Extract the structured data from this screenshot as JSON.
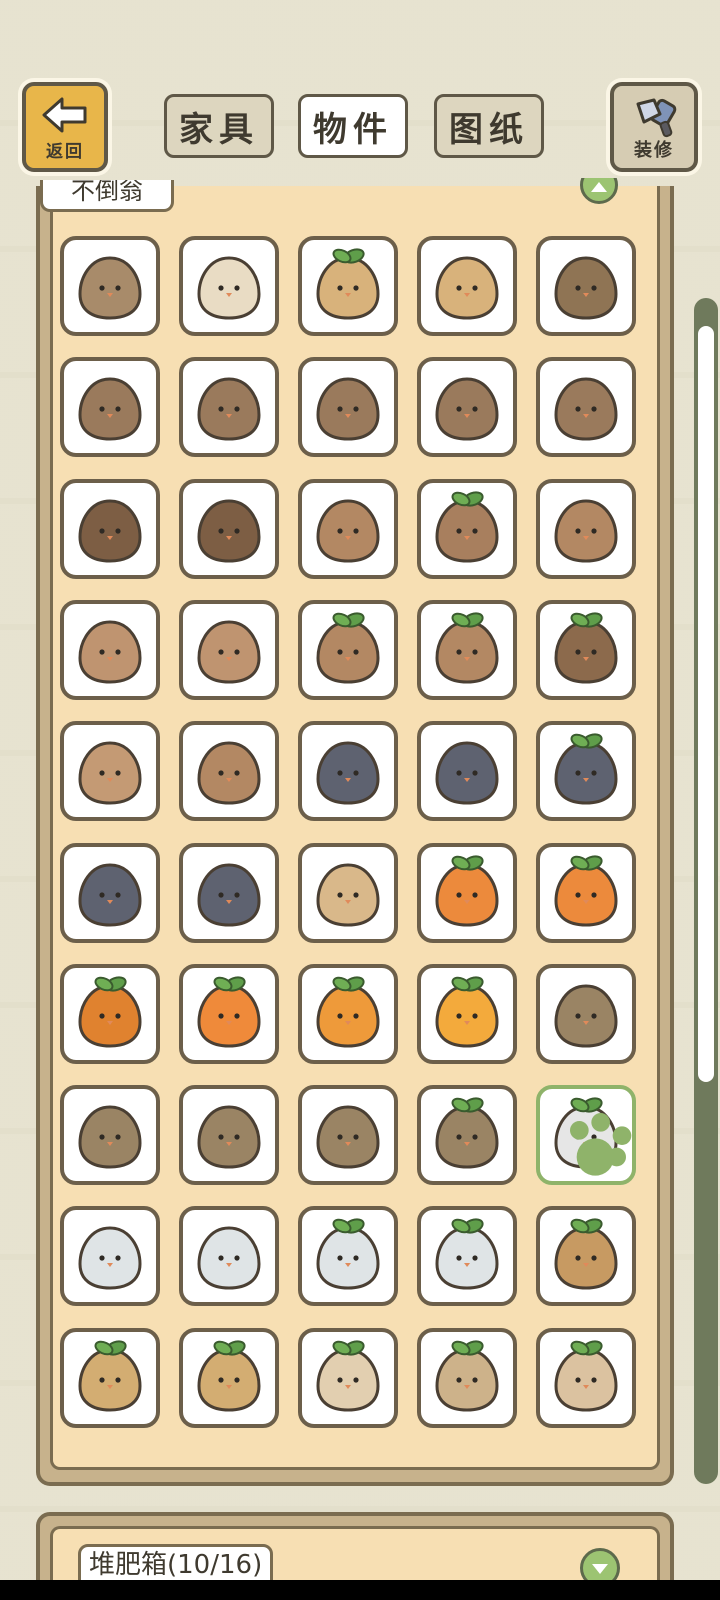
{
  "header": {
    "back_label": "返回",
    "decor_label": "装修",
    "tabs": [
      {
        "label": "家具",
        "active": false
      },
      {
        "label": "物件",
        "active": true
      },
      {
        "label": "图纸",
        "active": false
      }
    ]
  },
  "section": {
    "title": "不倒翁",
    "next_section_title": "堆肥箱(10/16)"
  },
  "items": [
    "daruma-1",
    "daruma-2",
    "daruma-3",
    "daruma-4",
    "daruma-5",
    "daruma-6",
    "daruma-7",
    "daruma-8",
    "daruma-9",
    "daruma-10",
    "daruma-11",
    "daruma-12",
    "daruma-13",
    "daruma-14",
    "daruma-15",
    "daruma-16",
    "daruma-17",
    "daruma-18",
    "daruma-19",
    "daruma-20",
    "daruma-21",
    "daruma-22",
    "daruma-23",
    "daruma-24",
    "daruma-25",
    "daruma-26",
    "daruma-27",
    "daruma-28",
    "daruma-29",
    "daruma-30",
    "daruma-31",
    "daruma-32",
    "daruma-33",
    "daruma-34",
    "daruma-35",
    "daruma-36",
    "daruma-37",
    "daruma-38",
    "daruma-39",
    "daruma-40",
    "daruma-41",
    "daruma-42",
    "daruma-43",
    "daruma-44",
    "daruma-45",
    "daruma-46",
    "daruma-47",
    "daruma-48",
    "daruma-49",
    "daruma-50"
  ],
  "item_colors": [
    "#a88b6a",
    "#e9dcc4",
    "#d8b27b",
    "#d8b27b",
    "#8f7454",
    "#9a7a5c",
    "#9a7a5c",
    "#9a7a5c",
    "#9a7a5c",
    "#9a7a5c",
    "#7d5e44",
    "#7d5e44",
    "#b38863",
    "#a87f5e",
    "#b38863",
    "#bf9470",
    "#bf9470",
    "#b38863",
    "#b38863",
    "#8c6a4c",
    "#c49a74",
    "#b38863",
    "#5e6270",
    "#5e6270",
    "#5e6270",
    "#5e6270",
    "#5e6270",
    "#d9b88a",
    "#ec8a3c",
    "#ec8a3c",
    "#e0822f",
    "#ef8a3a",
    "#ee9a3a",
    "#f3aa3c",
    "#9a8464",
    "#9a8464",
    "#9a8464",
    "#9a8464",
    "#9a8464",
    "#e6e6e6",
    "#dfe4e6",
    "#dfe4e6",
    "#dfe4e6",
    "#dfe4e6",
    "#c79a62",
    "#d3ad72",
    "#d3ad72",
    "#e2cfb0",
    "#cdb28a",
    "#dbc2a0"
  ],
  "leaf_rows": [
    0,
    0,
    1,
    0,
    0,
    0,
    0,
    0,
    0,
    0,
    0,
    0,
    0,
    1,
    0,
    0,
    0,
    1,
    1,
    1,
    0,
    0,
    0,
    0,
    1,
    0,
    0,
    0,
    1,
    1,
    1,
    1,
    1,
    1,
    0,
    0,
    0,
    0,
    1,
    1,
    0,
    0,
    1,
    1,
    1,
    1,
    1,
    1,
    1,
    1
  ],
  "selected_index": 39
}
